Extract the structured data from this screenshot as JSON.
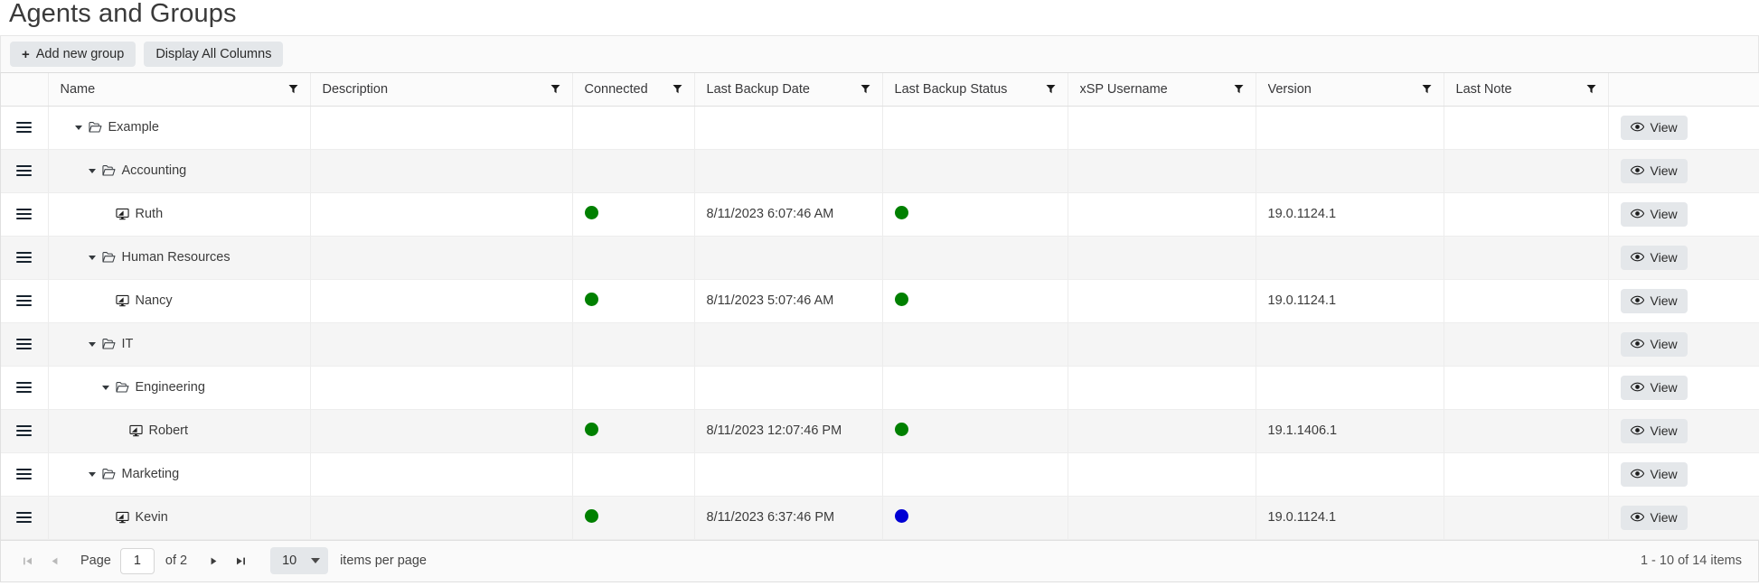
{
  "header": {
    "title": "Agents and Groups"
  },
  "toolbar": {
    "add_group_label": "Add new group",
    "add_group_plus": "+",
    "display_columns_label": "Display All Columns"
  },
  "grid": {
    "columns": [
      {
        "key": "handle",
        "label": "",
        "filter": false
      },
      {
        "key": "name",
        "label": "Name",
        "filter": true
      },
      {
        "key": "desc",
        "label": "Description",
        "filter": true
      },
      {
        "key": "conn",
        "label": "Connected",
        "filter": true
      },
      {
        "key": "lbdate",
        "label": "Last Backup Date",
        "filter": true
      },
      {
        "key": "lbstat",
        "label": "Last Backup Status",
        "filter": true
      },
      {
        "key": "xsp",
        "label": "xSP Username",
        "filter": true
      },
      {
        "key": "version",
        "label": "Version",
        "filter": true
      },
      {
        "key": "note",
        "label": "Last Note",
        "filter": true
      },
      {
        "key": "actions",
        "label": "",
        "filter": false
      }
    ],
    "view_button_label": "View",
    "rows": [
      {
        "type": "group",
        "level": 0,
        "name": "Example",
        "desc": "",
        "connected": "",
        "last_backup_date": "",
        "last_backup_status": "",
        "xsp": "",
        "version": "",
        "note": ""
      },
      {
        "type": "group",
        "level": 1,
        "name": "Accounting",
        "desc": "",
        "connected": "",
        "last_backup_date": "",
        "last_backup_status": "",
        "xsp": "",
        "version": "",
        "note": ""
      },
      {
        "type": "agent",
        "level": 2,
        "name": "Ruth",
        "desc": "",
        "connected": "green",
        "last_backup_date": "8/11/2023 6:07:46 AM",
        "last_backup_status": "green",
        "xsp": "",
        "version": "19.0.1124.1",
        "note": ""
      },
      {
        "type": "group",
        "level": 1,
        "name": "Human Resources",
        "desc": "",
        "connected": "",
        "last_backup_date": "",
        "last_backup_status": "",
        "xsp": "",
        "version": "",
        "note": ""
      },
      {
        "type": "agent",
        "level": 2,
        "name": "Nancy",
        "desc": "",
        "connected": "green",
        "last_backup_date": "8/11/2023 5:07:46 AM",
        "last_backup_status": "green",
        "xsp": "",
        "version": "19.0.1124.1",
        "note": ""
      },
      {
        "type": "group",
        "level": 1,
        "name": "IT",
        "desc": "",
        "connected": "",
        "last_backup_date": "",
        "last_backup_status": "",
        "xsp": "",
        "version": "",
        "note": ""
      },
      {
        "type": "group",
        "level": 2,
        "name": "Engineering",
        "desc": "",
        "connected": "",
        "last_backup_date": "",
        "last_backup_status": "",
        "xsp": "",
        "version": "",
        "note": ""
      },
      {
        "type": "agent",
        "level": 3,
        "name": "Robert",
        "desc": "",
        "connected": "green",
        "last_backup_date": "8/11/2023 12:07:46 PM",
        "last_backup_status": "green",
        "xsp": "",
        "version": "19.1.1406.1",
        "note": ""
      },
      {
        "type": "group",
        "level": 1,
        "name": "Marketing",
        "desc": "",
        "connected": "",
        "last_backup_date": "",
        "last_backup_status": "",
        "xsp": "",
        "version": "",
        "note": ""
      },
      {
        "type": "agent",
        "level": 2,
        "name": "Kevin",
        "desc": "",
        "connected": "green",
        "last_backup_date": "8/11/2023 6:37:46 PM",
        "last_backup_status": "blue",
        "xsp": "",
        "version": "19.0.1124.1",
        "note": ""
      }
    ]
  },
  "pager": {
    "first_icon": "first-page-icon",
    "prev_icon": "previous-page-icon",
    "next_icon": "next-page-icon",
    "last_icon": "last-page-icon",
    "page_label": "Page",
    "page_value": "1",
    "of_label": "of 2",
    "page_size": "10",
    "items_per_page_label": "items per page",
    "summary": "1 - 10 of 14 items"
  },
  "colors": {
    "status_green": "#008000",
    "status_blue": "#0000d4",
    "button_bg": "#e4e7ea",
    "row_alt_bg": "#f5f5f5",
    "toolbar_bg": "#fafafa"
  }
}
